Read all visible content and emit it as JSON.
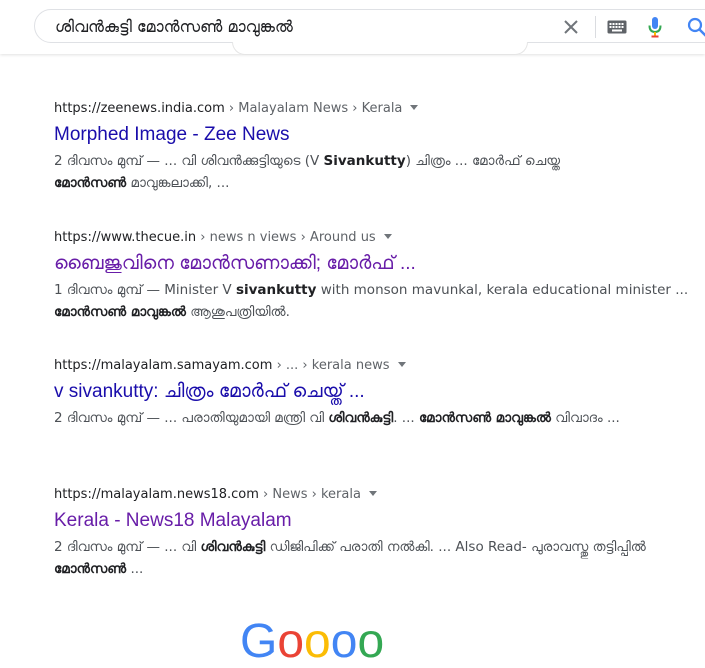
{
  "search": {
    "query": "ശിവൻകുട്ടി മോൻസൺ മാവുങ്കൽ",
    "clear_icon": "close-icon",
    "keyboard_icon": "keyboard-icon",
    "mic_icon": "microphone-icon",
    "search_icon": "search-icon"
  },
  "results": [
    {
      "site": "https://zeenews.india.com",
      "path": " › Malayalam News › Kerala",
      "title": "Morphed Image - Zee News",
      "snippet_parts": [
        "2 ദിവസം മുമ്പ് — ... വി ശിവൻക്കുട്ടിയുടെ (V ",
        "Sivankutty",
        ") ചിത്രം ... മോർഫ് ചെയ്ത",
        "മോൻസൺ",
        " മാവുങ്കലാക്കി, ..."
      ]
    },
    {
      "site": "https://www.thecue.in",
      "path": " › news n views › Around us",
      "title": "ബൈജുവിനെ മോൻസണാക്കി; മോർഫ് ...",
      "snippet_parts": [
        "1 ദിവസം മുമ്പ് — Minister V ",
        "sivankutty",
        " with monson mavunkal, kerala educational minister ... ",
        "മോൻസൺ മാവുങ്കൽ",
        " ആശുപത്രിയിൽ."
      ]
    },
    {
      "site": "https://malayalam.samayam.com",
      "path": " › ... › kerala news",
      "title": "v sivankutty: ചിത്രം മോർഫ് ചെയ്ത് ...",
      "snippet_parts": [
        "2 ദിവസം മുമ്പ് — ... പരാതിയുമായി മന്ത്രി വി ",
        "ശിവൻകുട്ടി",
        ". ... ",
        "മോൻസൺ മാവുങ്കൽ",
        " വിവാദം ..."
      ]
    },
    {
      "site": "https://malayalam.news18.com",
      "path": " › News › kerala",
      "title": "Kerala - News18 Malayalam",
      "snippet_parts": [
        "2 ദിവസം മുമ്പ് — ... വി ",
        "ശിവൻകുട്ടി",
        " ഡിജിപിക്ക് പരാതി നൽകി. ... Also Read- പുരാവസ്തു തട്ടിപ്പിൽ ",
        "മോൻസൺ",
        " ..."
      ]
    }
  ],
  "footer": {
    "logo_partial": "Goooooogle"
  }
}
